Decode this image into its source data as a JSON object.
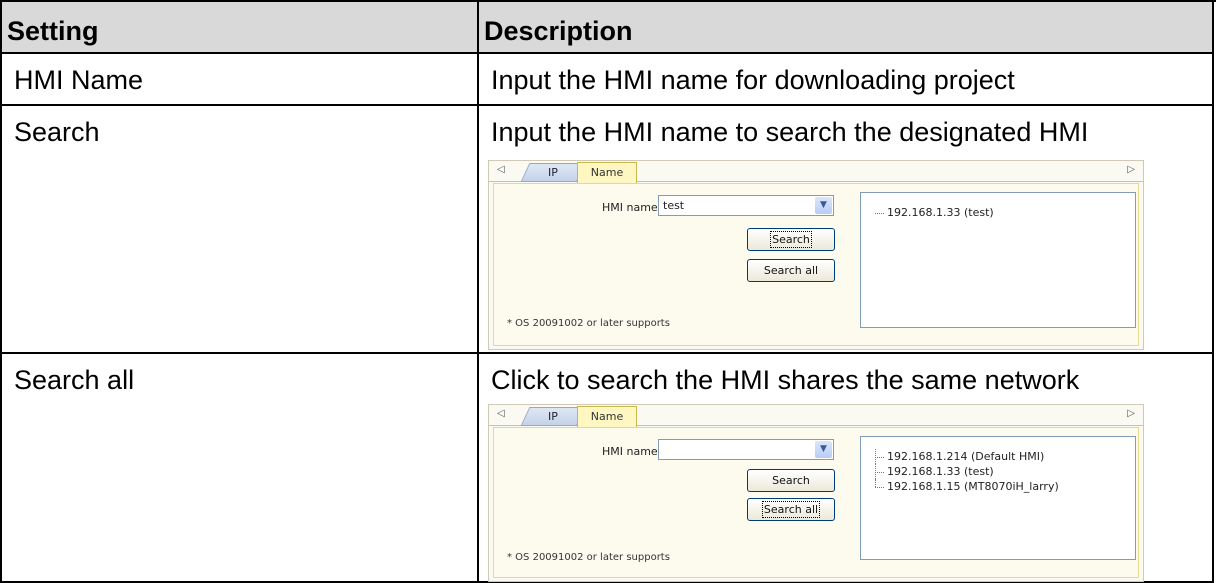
{
  "table": {
    "headers": {
      "setting": "Setting",
      "description": "Description"
    },
    "rows": [
      {
        "setting": "HMI Name",
        "description": "Input the HMI name for downloading project"
      },
      {
        "setting": "Search",
        "description": "Input the HMI name to search the designated HMI"
      },
      {
        "setting": "Search all",
        "description": "Click to search the HMI shares the same network"
      }
    ]
  },
  "dialog1": {
    "tabs": [
      "IP",
      "Name"
    ],
    "hmi_name_label": "HMI name :",
    "hmi_name_value": "test",
    "search_button": "Search",
    "search_all_button": "Search all",
    "note": "* OS 20091002 or later supports",
    "results": [
      "192.168.1.33 (test)"
    ]
  },
  "dialog2": {
    "tabs": [
      "IP",
      "Name"
    ],
    "hmi_name_label": "HMI name :",
    "hmi_name_value": "",
    "search_button": "Search",
    "search_all_button": "Search all",
    "note": "* OS 20091002 or later supports",
    "results": [
      "192.168.1.214 (Default HMI)",
      "192.168.1.33 (test)",
      "192.168.1.15 (MT8070iH_larry)"
    ]
  },
  "icons": {
    "tab_scroll_left": "left-triangle-icon",
    "tab_scroll_right": "right-triangle-icon",
    "dropdown": "chevron-down-icon"
  }
}
